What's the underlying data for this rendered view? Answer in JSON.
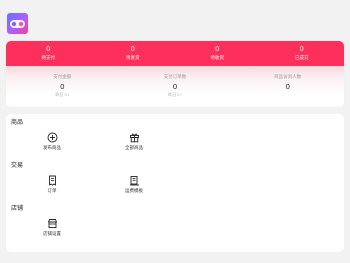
{
  "app": {
    "logo_icon": "game-controller-icon"
  },
  "orders": [
    {
      "count": "0",
      "label": "待支付"
    },
    {
      "count": "0",
      "label": "待发货"
    },
    {
      "count": "0",
      "label": "待收货"
    },
    {
      "count": "0",
      "label": "已成交"
    }
  ],
  "metrics": [
    {
      "label": "支付金额",
      "value": "0",
      "sub": "昨日 0 ›"
    },
    {
      "label": "支付订单数",
      "value": "0",
      "sub": "昨日 0 ›"
    },
    {
      "label": "商品访问人数",
      "value": "0",
      "sub": ""
    }
  ],
  "sections": [
    {
      "title": "商品",
      "items": [
        {
          "label": "发布商品",
          "icon": "plus-circle-icon"
        },
        {
          "label": "全部商品",
          "icon": "gift-icon"
        }
      ]
    },
    {
      "title": "交易",
      "items": [
        {
          "label": "订单",
          "icon": "order-doc-icon"
        },
        {
          "label": "运费模板",
          "icon": "shipping-template-icon"
        }
      ]
    },
    {
      "title": "店铺",
      "items": [
        {
          "label": "店铺设置",
          "icon": "store-icon"
        }
      ]
    }
  ],
  "colors": {
    "accent": "#ff2f5c",
    "background": "#f2f2f2"
  }
}
